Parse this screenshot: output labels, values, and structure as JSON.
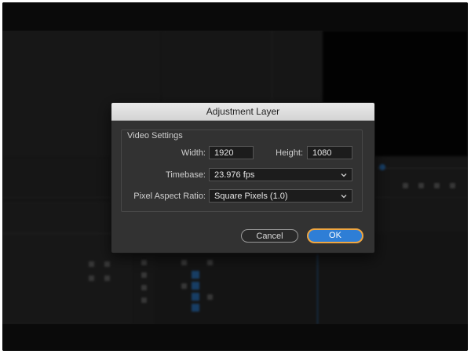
{
  "dialog": {
    "title": "Adjustment Layer",
    "group_title": "Video Settings",
    "width_label": "Width:",
    "width_value": "1920",
    "height_label": "Height:",
    "height_value": "1080",
    "timebase_label": "Timebase:",
    "timebase_value": "23.976 fps",
    "par_label": "Pixel Aspect Ratio:",
    "par_value": "Square Pixels (1.0)",
    "cancel_label": "Cancel",
    "ok_label": "OK"
  },
  "colors": {
    "accent": "#2e7ed6",
    "focus_ring": "#f0a640",
    "dialog_bg": "#323232",
    "track_blue": "#2b78c6"
  },
  "icons": {
    "dropdown": "chevron-down-icon"
  }
}
